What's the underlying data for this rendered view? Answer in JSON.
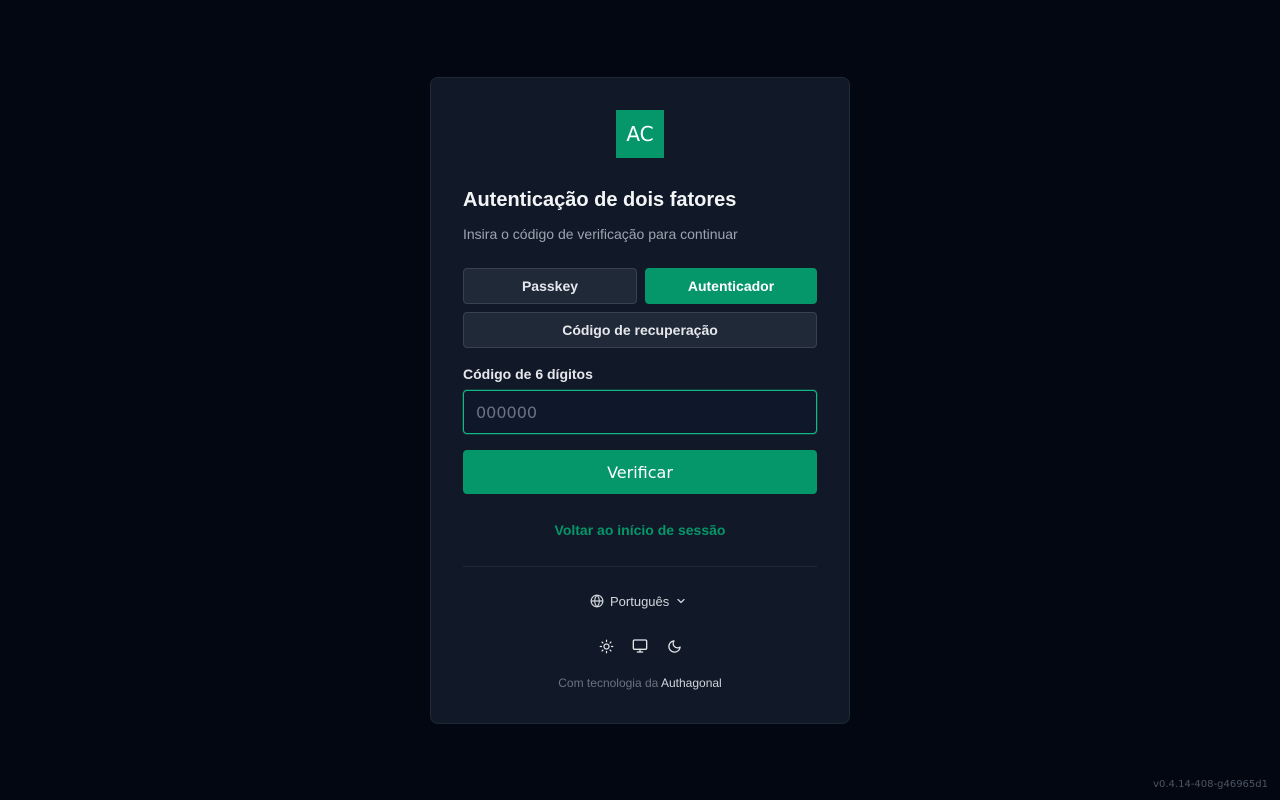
{
  "logo": {
    "text": "AC",
    "color": "#059669"
  },
  "heading": {
    "title": "Autenticação de dois fatores",
    "subtitle": "Insira o código de verificação para continuar"
  },
  "methods": {
    "passkey": "Passkey",
    "authenticator": "Autenticador",
    "recovery": "Código de recuperação",
    "active": "authenticator"
  },
  "code_field": {
    "label": "Código de 6 dígitos",
    "value": "",
    "placeholder": "000000"
  },
  "verify_button": "Verificar",
  "back_link": "Voltar ao início de sessão",
  "language": {
    "selected": "Português",
    "icon": "globe-icon"
  },
  "theme": {
    "icons": [
      "sun-icon",
      "monitor-icon",
      "moon-icon"
    ]
  },
  "footer": {
    "powered_prefix": "Com tecnologia da",
    "brand": "Authagonal"
  },
  "version": "v0.4.14-408-g46965d1",
  "colors": {
    "accent": "#059669",
    "background": "#030712",
    "card": "#111827"
  }
}
